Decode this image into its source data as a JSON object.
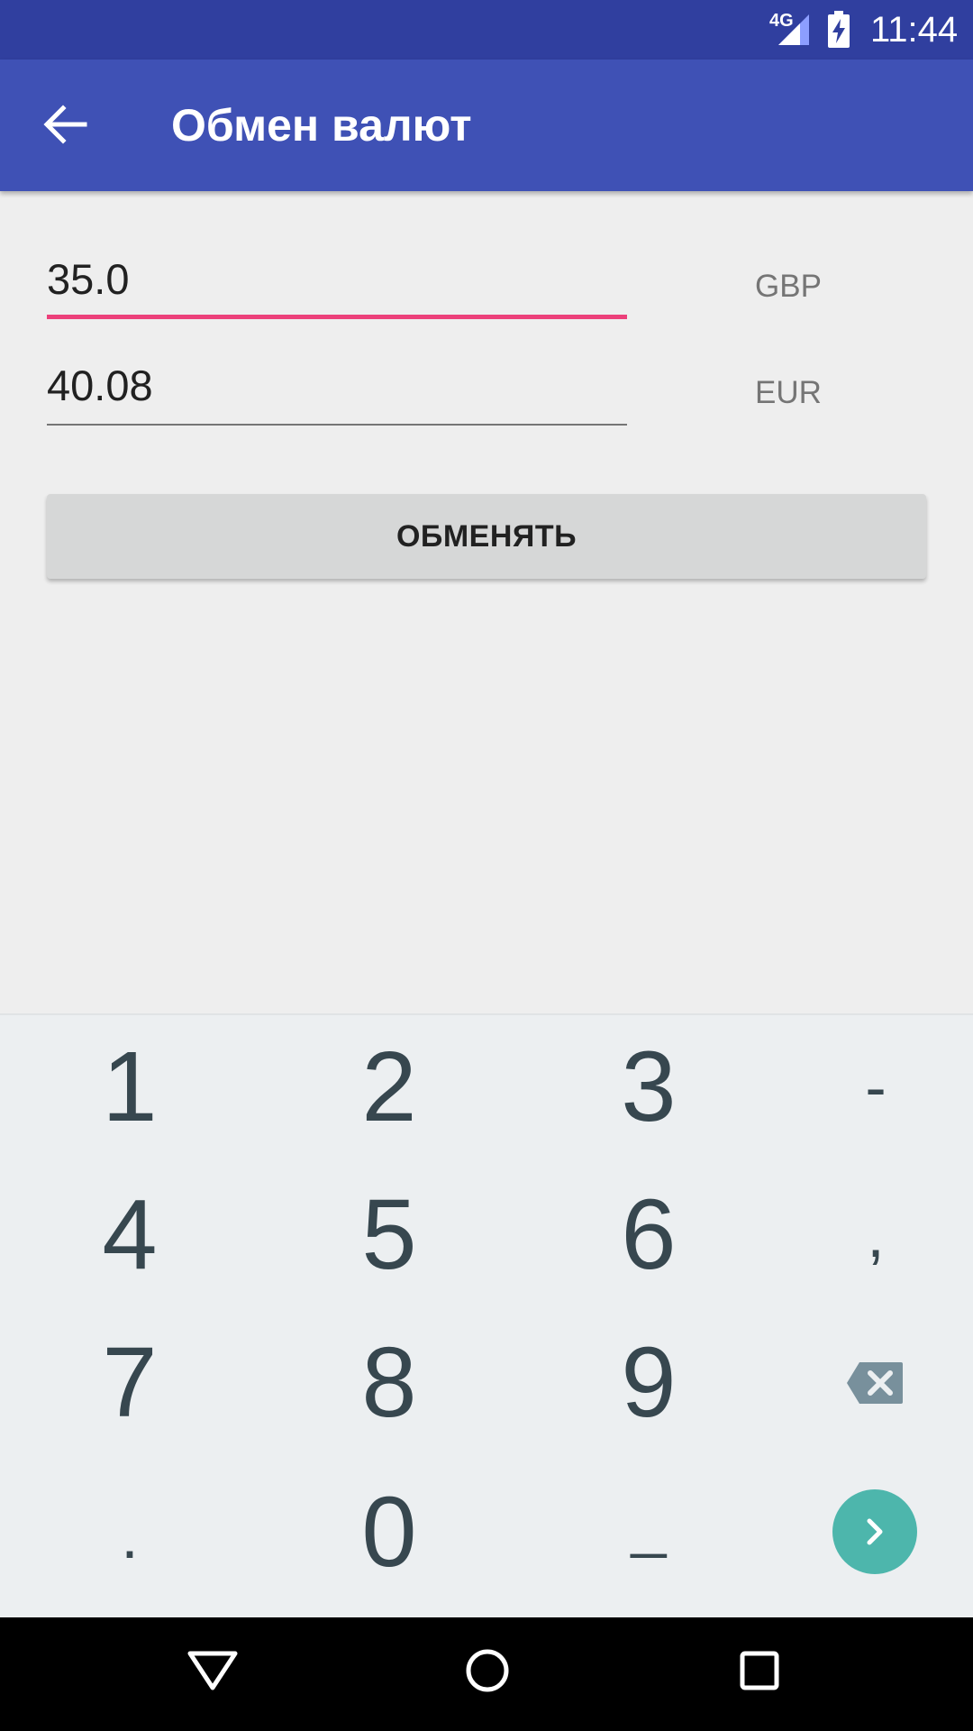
{
  "status_bar": {
    "network": "4G",
    "time": "11:44"
  },
  "app_bar": {
    "title": "Обмен валют"
  },
  "form": {
    "amount_from": "35.0",
    "currency_from": "GBP",
    "amount_to": "40.08",
    "currency_to": "EUR",
    "exchange_button": "ОБМЕНЯТЬ"
  },
  "keyboard": {
    "keys": [
      "1",
      "2",
      "3",
      "-",
      "4",
      "5",
      "6",
      ",",
      "7",
      "8",
      "9",
      ".",
      "0",
      "_"
    ],
    "icons": [
      "backspace-icon",
      "go-icon"
    ]
  },
  "nav": {
    "icons": [
      "back-triangle-icon",
      "home-circle-icon",
      "recents-square-icon"
    ]
  },
  "colors": {
    "primary": "#3f51b5",
    "primary_dark": "#303f9f",
    "accent": "#ec407a",
    "go_button": "#4db6ac"
  }
}
